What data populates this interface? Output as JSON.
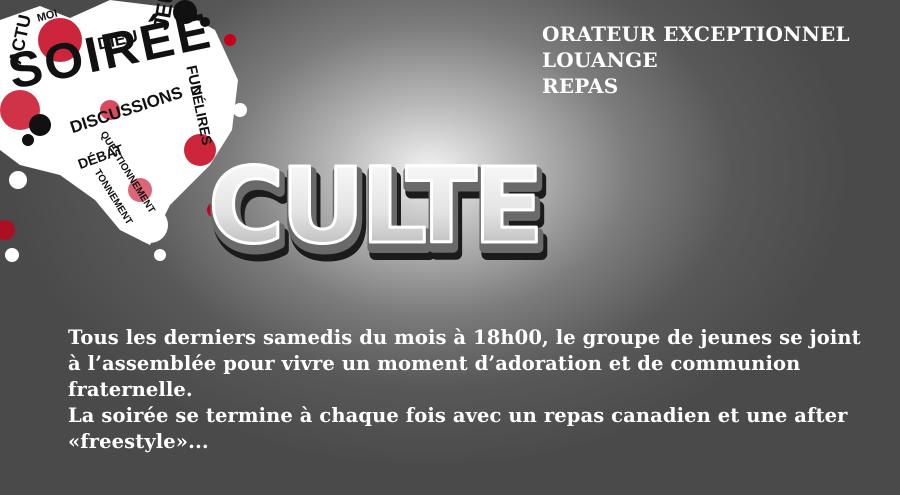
{
  "logo": {
    "text": "CULTE"
  },
  "splash": {
    "words": {
      "soiree": "SOIRÉE",
      "actu": "ACTU",
      "moi": "MOI",
      "dieu": "DIEU",
      "jeu": "JEU",
      "fun": "FUN",
      "delires": "DÉLIRES",
      "discussions": "DISCUSSIONS",
      "questionnement": "QUESTIONNEMENT",
      "debat": "DÉBAT",
      "tonnement": "TONNEMENT"
    },
    "colors": {
      "splatter": "#c4001a",
      "ink": "#111111",
      "paper": "#ffffff"
    }
  },
  "features": [
    "ORATEUR EXCEPTIONNEL",
    "LOUANGE",
    "REPAS"
  ],
  "body": {
    "paragraph_1": "Tous les derniers samedis du mois à 18h00, le groupe de jeunes se joint à l’assemblée pour vivre un moment d’adoration et de communion fraternelle.",
    "paragraph_2": "La soirée se termine à chaque fois avec un repas canadien et une after «freestyle»..."
  }
}
